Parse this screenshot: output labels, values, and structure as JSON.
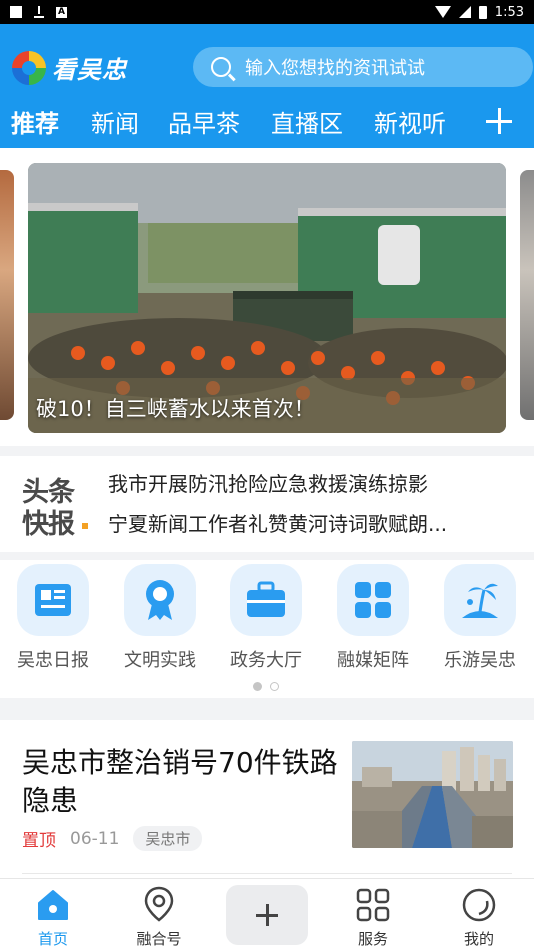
{
  "status_bar": {
    "time": "1:53"
  },
  "header": {
    "app_name": "看吴忠",
    "search_placeholder": "输入您想找的资讯试试",
    "tabs": [
      "推荐",
      "新闻",
      "品早茶",
      "直播区",
      "新视听"
    ],
    "active_tab": "推荐"
  },
  "banner": {
    "caption": "破10！自三峡蓄水以来首次！"
  },
  "headlines": {
    "badge_top": "头条",
    "badge_bottom": "快报",
    "items": [
      "我市开展防汛抢险应急救援演练掠影",
      "宁夏新闻工作者礼赞黄河诗词歌赋朗..."
    ]
  },
  "services": [
    {
      "label": "吴忠日报",
      "icon": "newspaper-icon"
    },
    {
      "label": "文明实践",
      "icon": "ribbon-badge-icon"
    },
    {
      "label": "政务大厅",
      "icon": "briefcase-icon"
    },
    {
      "label": "融媒矩阵",
      "icon": "grid-apps-icon"
    },
    {
      "label": "乐游吴忠",
      "icon": "palm-island-icon"
    }
  ],
  "article": {
    "title": "吴忠市整治销号70件铁路隐患",
    "pin": "置顶",
    "date": "06-11",
    "location": "吴忠市"
  },
  "bottom_nav": {
    "items": [
      "首页",
      "融合号",
      "服务",
      "我的"
    ],
    "active": "首页"
  },
  "colors": {
    "brand": "#1a98ee",
    "pin": "#e23a3a"
  }
}
